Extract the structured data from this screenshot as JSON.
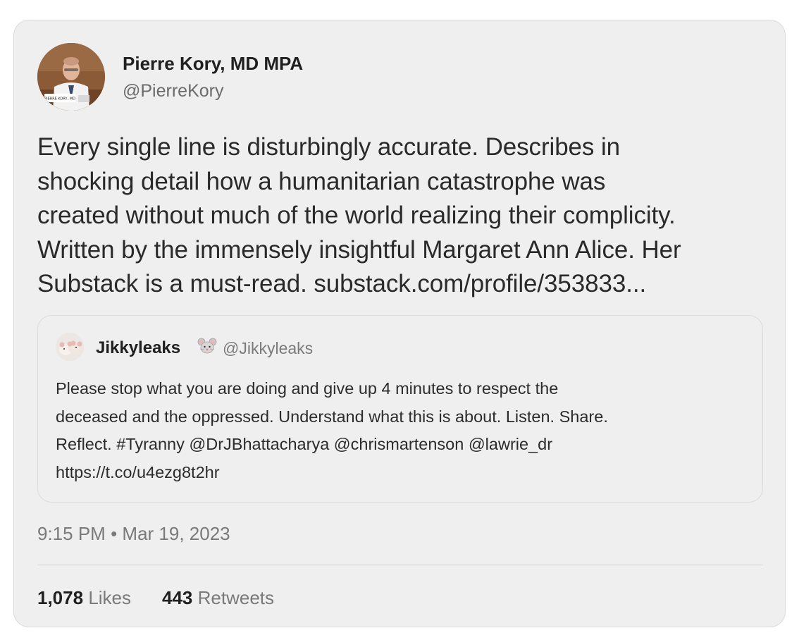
{
  "tweet": {
    "author": {
      "name": "Pierre Kory, MD MPA",
      "handle": "@PierreKory",
      "avatar_label": "PIERRE KORY, MD"
    },
    "text_lines": [
      "Every single line is disturbingly accurate. Describes in",
      "shocking detail how a humanitarian catastrophe was",
      "created without much of the world realizing their complicity.",
      "Written by the immensely insightful Margaret Ann Alice. Her",
      "Substack is a must-read. substack.com/profile/353833..."
    ],
    "quoted": {
      "name": "Jikkyleaks",
      "emoji_icon": "mouse-face-icon",
      "handle": "@Jikkyleaks",
      "text_lines": [
        "Please stop what you are doing and give up 4 minutes to respect the",
        "deceased and the oppressed. Understand what this is about. Listen. Share.",
        "Reflect. #Tyranny @DrJBhattacharya @chrismartenson @lawrie_dr",
        "https://t.co/u4ezg8t2hr"
      ]
    },
    "time": "9:15 PM",
    "separator": "•",
    "date": "Mar 19, 2023",
    "likes_count": "1,078",
    "likes_label": "Likes",
    "retweets_count": "443",
    "retweets_label": "Retweets"
  }
}
